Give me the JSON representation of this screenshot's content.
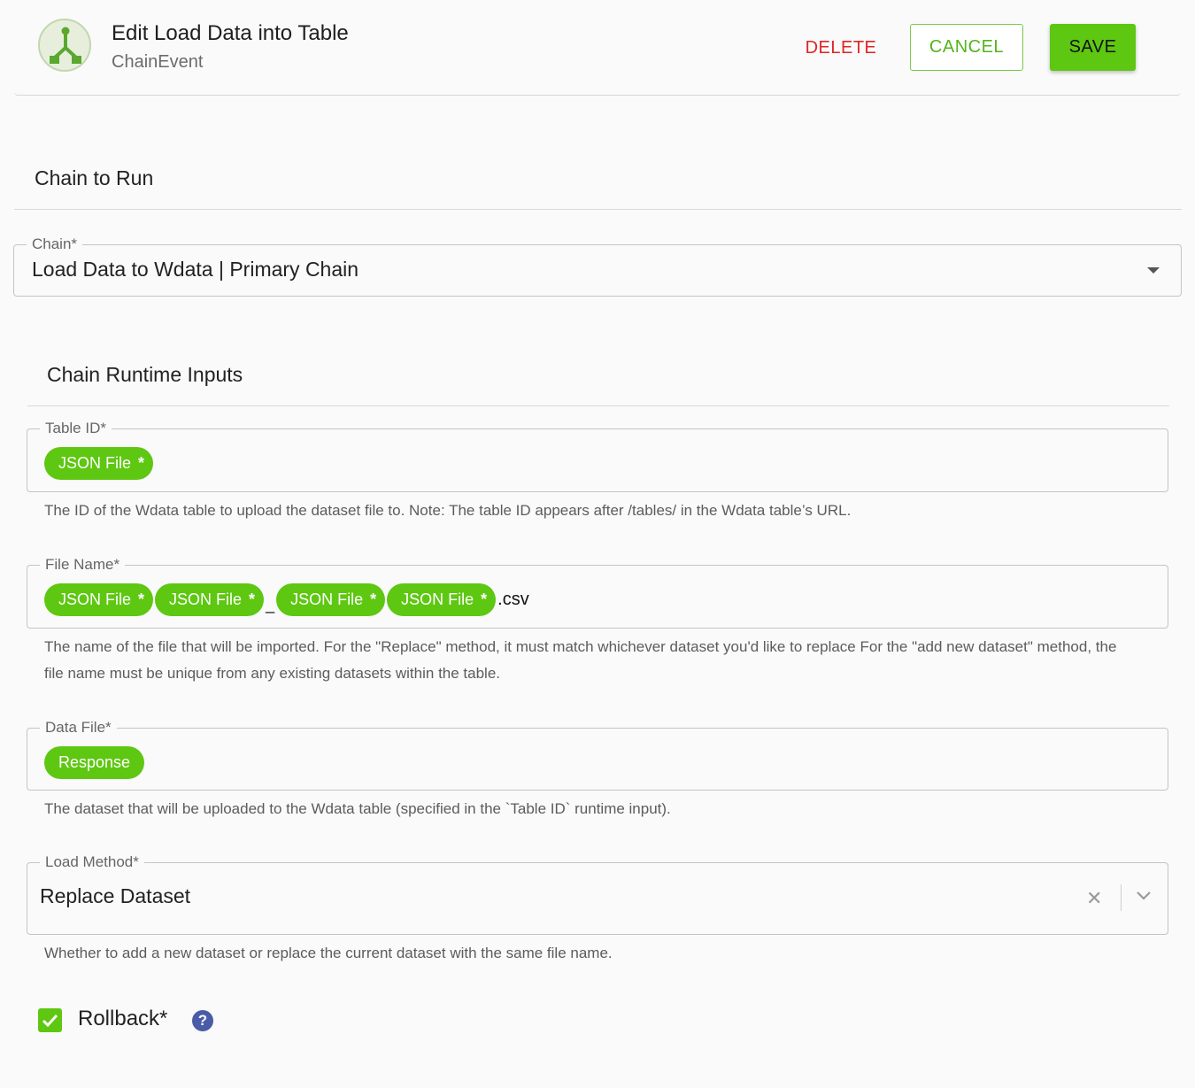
{
  "header": {
    "title": "Edit Load Data into Table",
    "subtitle": "ChainEvent",
    "delete_label": "DELETE",
    "cancel_label": "CANCEL",
    "save_label": "SAVE",
    "logo_icon": "chain-branch-icon"
  },
  "chain_section": {
    "title": "Chain to Run",
    "chain_field": {
      "label": "Chain*",
      "value": "Load Data to Wdata | Primary Chain"
    }
  },
  "runtime_section": {
    "title": "Chain Runtime Inputs",
    "table_id": {
      "label": "Table ID*",
      "chips": [
        "JSON File"
      ],
      "helper": "The ID of the Wdata table to upload the dataset file to. Note: The table ID appears after /tables/ in the Wdata table’s URL."
    },
    "file_name": {
      "label": "File Name*",
      "chips": [
        "JSON File",
        "JSON File",
        "JSON File",
        "JSON File"
      ],
      "separator": "_",
      "suffix": ".csv",
      "helper": "The name of the file that will be imported. For the \"Replace\" method, it must match whichever dataset you'd like to replace For the \"add new dataset\" method, the file name must be unique from any existing datasets within the table."
    },
    "data_file": {
      "label": "Data File*",
      "chips": [
        "Response"
      ],
      "helper": "The dataset that will be uploaded to the Wdata table (specified in the `Table ID` runtime input)."
    },
    "load_method": {
      "label": "Load Method*",
      "value": "Replace Dataset",
      "helper": "Whether to add a new dataset or replace the current dataset with the same file name."
    },
    "rollback": {
      "label": "Rollback*",
      "checked": true,
      "help_symbol": "?"
    }
  },
  "chip_star": "*",
  "clear_symbol": "✕",
  "colors": {
    "accent": "#5ec712",
    "danger": "#e02424",
    "help": "#4a5ba8"
  }
}
